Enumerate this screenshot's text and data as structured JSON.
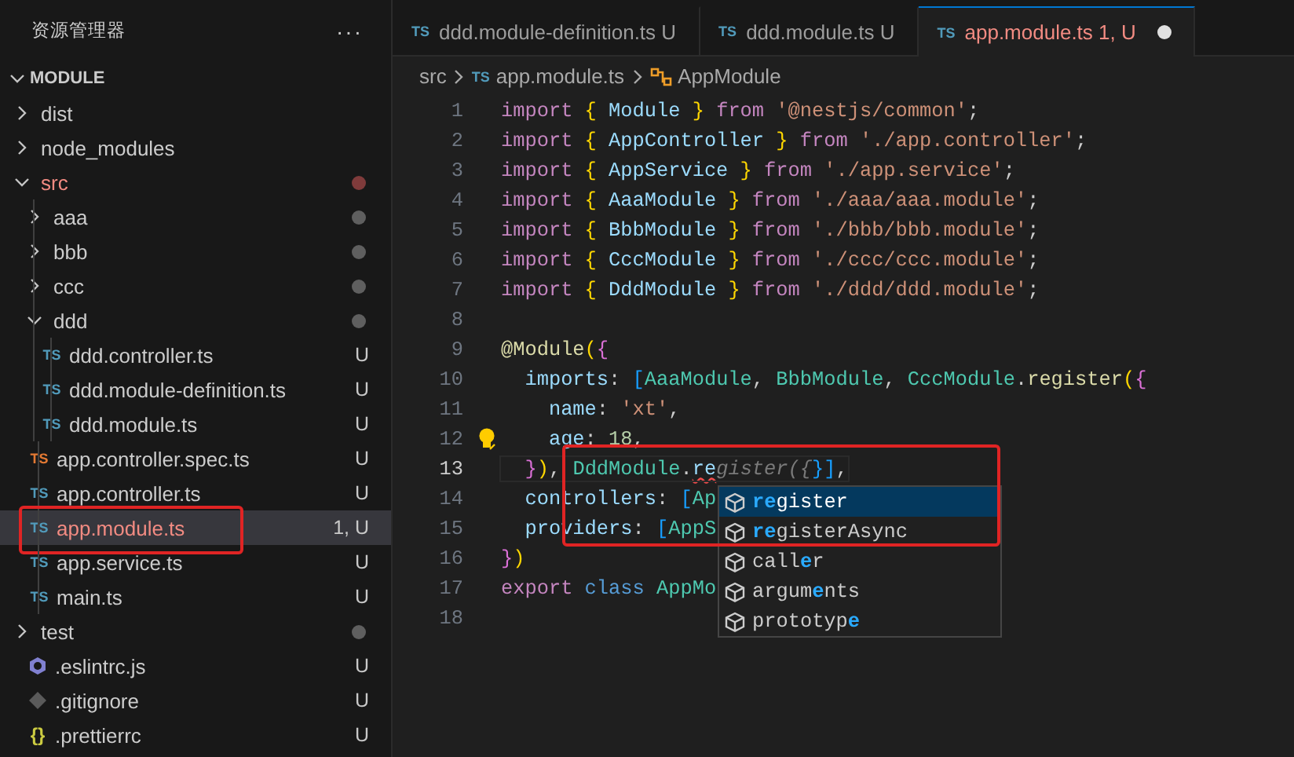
{
  "sidebar": {
    "title": "资源管理器",
    "menu": "···",
    "section": {
      "label": "MODULE",
      "expanded": true
    },
    "items": [
      {
        "label": "dist",
        "kind": "folder",
        "expanded": false,
        "problem": false
      },
      {
        "label": "node_modules",
        "kind": "folder",
        "expanded": false,
        "problem": false
      },
      {
        "label": "src",
        "kind": "folder",
        "expanded": true,
        "problem": true,
        "color": "#7f3b3b",
        "children": [
          {
            "label": "aaa",
            "kind": "folder",
            "expanded": false,
            "problem": false,
            "color": "#5f5f5f"
          },
          {
            "label": "bbb",
            "kind": "folder",
            "expanded": false,
            "problem": false,
            "color": "#5f5f5f"
          },
          {
            "label": "ccc",
            "kind": "folder",
            "expanded": false,
            "problem": false,
            "color": "#5f5f5f"
          },
          {
            "label": "ddd",
            "kind": "folder",
            "expanded": true,
            "problem": false,
            "color": "#5f5f5f",
            "children": [
              {
                "label": "ddd.controller.ts",
                "kind": "ts",
                "icon_label": "TS",
                "status": "U",
                "problem": false
              },
              {
                "label": "ddd.module-definition.ts",
                "kind": "ts",
                "icon_label": "TS",
                "status": "U",
                "problem": false
              },
              {
                "label": "ddd.module.ts",
                "kind": "ts",
                "icon_label": "TS",
                "status": "U",
                "problem": false
              }
            ]
          },
          {
            "label": "app.controller.spec.ts",
            "kind": "test",
            "icon_label": "TS",
            "status": "U",
            "problem": false
          },
          {
            "label": "app.controller.ts",
            "kind": "ts",
            "icon_label": "TS",
            "status": "U",
            "problem": false
          },
          {
            "label": "app.module.ts",
            "kind": "ts",
            "icon_label": "TS",
            "status": "1, U",
            "problem": true,
            "selected": true,
            "outlined": true
          },
          {
            "label": "app.service.ts",
            "kind": "ts",
            "icon_label": "TS",
            "status": "U",
            "problem": false
          },
          {
            "label": "main.ts",
            "kind": "ts",
            "icon_label": "TS",
            "status": "U",
            "problem": false
          }
        ]
      },
      {
        "label": "test",
        "kind": "folder",
        "expanded": false,
        "problem": false,
        "color": "#5f5f5f"
      },
      {
        "label": ".eslintrc.js",
        "kind": "eslint",
        "status": "U",
        "problem": false
      },
      {
        "label": ".gitignore",
        "kind": "git",
        "status": "U",
        "problem": false
      },
      {
        "label": ".prettierrc",
        "kind": "json",
        "icon_label": "{}",
        "status": "U",
        "problem": false
      }
    ]
  },
  "tabs": [
    {
      "icon_label": "TS",
      "label": "ddd.module-definition.ts",
      "status": "U",
      "selected": false,
      "problem": false,
      "modified": false
    },
    {
      "icon_label": "TS",
      "label": "ddd.module.ts",
      "status": "U",
      "selected": false,
      "problem": false,
      "modified": false
    },
    {
      "icon_label": "TS",
      "label": "app.module.ts",
      "status": "1, U",
      "selected": true,
      "problem": true,
      "modified": true
    }
  ],
  "breadcrumb": {
    "folder": "src",
    "icon_label": "TS",
    "file": "app.module.ts",
    "symbol": "AppModule"
  },
  "editor": {
    "outlined": true,
    "lines": [
      {
        "number": "1",
        "tokens": [
          {
            "kind": "kw",
            "t": "import "
          },
          {
            "kind": "br",
            "t": "{"
          },
          {
            "kind": "var",
            "t": " Module "
          },
          {
            "kind": "br",
            "t": "}"
          },
          {
            "kind": "kw",
            "t": " from "
          },
          {
            "kind": "str",
            "t": "'@nestjs/common'"
          },
          {
            "kind": "p",
            "t": ";"
          }
        ]
      },
      {
        "number": "2",
        "tokens": [
          {
            "kind": "kw",
            "t": "import "
          },
          {
            "kind": "br",
            "t": "{"
          },
          {
            "kind": "var",
            "t": " AppController "
          },
          {
            "kind": "br",
            "t": "}"
          },
          {
            "kind": "kw",
            "t": " from "
          },
          {
            "kind": "str",
            "t": "'./app.controller'"
          },
          {
            "kind": "p",
            "t": ";"
          }
        ]
      },
      {
        "number": "3",
        "tokens": [
          {
            "kind": "kw",
            "t": "import "
          },
          {
            "kind": "br",
            "t": "{"
          },
          {
            "kind": "var",
            "t": " AppService "
          },
          {
            "kind": "br",
            "t": "}"
          },
          {
            "kind": "kw",
            "t": " from "
          },
          {
            "kind": "str",
            "t": "'./app.service'"
          },
          {
            "kind": "p",
            "t": ";"
          }
        ]
      },
      {
        "number": "4",
        "tokens": [
          {
            "kind": "kw",
            "t": "import "
          },
          {
            "kind": "br",
            "t": "{"
          },
          {
            "kind": "var",
            "t": " AaaModule "
          },
          {
            "kind": "br",
            "t": "}"
          },
          {
            "kind": "kw",
            "t": " from "
          },
          {
            "kind": "str",
            "t": "'./aaa/aaa.module'"
          },
          {
            "kind": "p",
            "t": ";"
          }
        ]
      },
      {
        "number": "5",
        "tokens": [
          {
            "kind": "kw",
            "t": "import "
          },
          {
            "kind": "br",
            "t": "{"
          },
          {
            "kind": "var",
            "t": " BbbModule "
          },
          {
            "kind": "br",
            "t": "}"
          },
          {
            "kind": "kw",
            "t": " from "
          },
          {
            "kind": "str",
            "t": "'./bbb/bbb.module'"
          },
          {
            "kind": "p",
            "t": ";"
          }
        ]
      },
      {
        "number": "6",
        "tokens": [
          {
            "kind": "kw",
            "t": "import "
          },
          {
            "kind": "br",
            "t": "{"
          },
          {
            "kind": "var",
            "t": " CccModule "
          },
          {
            "kind": "br",
            "t": "}"
          },
          {
            "kind": "kw",
            "t": " from "
          },
          {
            "kind": "str",
            "t": "'./ccc/ccc.module'"
          },
          {
            "kind": "p",
            "t": ";"
          }
        ]
      },
      {
        "number": "7",
        "tokens": [
          {
            "kind": "kw",
            "t": "import "
          },
          {
            "kind": "br",
            "t": "{"
          },
          {
            "kind": "var",
            "t": " DddModule "
          },
          {
            "kind": "br",
            "t": "}"
          },
          {
            "kind": "kw",
            "t": " from "
          },
          {
            "kind": "str",
            "t": "'./ddd/ddd.module'"
          },
          {
            "kind": "p",
            "t": ";"
          }
        ]
      },
      {
        "number": "8"
      },
      {
        "number": "9",
        "tokens": [
          {
            "kind": "fn",
            "t": "@Module"
          },
          {
            "kind": "br",
            "t": "("
          },
          {
            "kind": "br2",
            "t": "{"
          }
        ]
      },
      {
        "number": "10",
        "tokens": [
          {
            "kind": "var",
            "t": "  imports"
          },
          {
            "kind": "p",
            "t": ": "
          },
          {
            "kind": "br3",
            "t": "["
          },
          {
            "kind": "type",
            "t": "AaaModule"
          },
          {
            "kind": "p",
            "t": ", "
          },
          {
            "kind": "type",
            "t": "BbbModule"
          },
          {
            "kind": "p",
            "t": ", "
          },
          {
            "kind": "type",
            "t": "CccModule"
          },
          {
            "kind": "p",
            "t": "."
          },
          {
            "kind": "fn",
            "t": "register"
          },
          {
            "kind": "br",
            "t": "("
          },
          {
            "kind": "br2",
            "t": "{"
          }
        ]
      },
      {
        "number": "11",
        "tokens": [
          {
            "kind": "var",
            "t": "    name"
          },
          {
            "kind": "p",
            "t": ": "
          },
          {
            "kind": "str",
            "t": "'xt'"
          },
          {
            "kind": "p",
            "t": ","
          }
        ]
      },
      {
        "number": "12",
        "lightbulb": true,
        "tokens": [
          {
            "kind": "var",
            "t": "    age"
          },
          {
            "kind": "p",
            "t": ": "
          },
          {
            "kind": "num",
            "t": "18"
          },
          {
            "kind": "p",
            "t": ","
          }
        ]
      },
      {
        "number": "13",
        "current": true,
        "tokens": [
          {
            "kind": "br2",
            "t": "  }"
          },
          {
            "kind": "br",
            "t": ")"
          },
          {
            "kind": "p",
            "t": ", "
          },
          {
            "kind": "type",
            "t": "DddModule"
          },
          {
            "kind": "p",
            "t": "."
          },
          {
            "kind": "err",
            "t": "re"
          },
          {
            "kind": "ghost",
            "t": "gister({"
          },
          {
            "kind": "br3",
            "t": "}]"
          },
          {
            "kind": "p",
            "t": ","
          }
        ]
      },
      {
        "number": "14",
        "tokens": [
          {
            "kind": "var",
            "t": "  controllers"
          },
          {
            "kind": "p",
            "t": ": "
          },
          {
            "kind": "br3",
            "t": "["
          },
          {
            "kind": "type",
            "t": "Ap"
          }
        ]
      },
      {
        "number": "15",
        "tokens": [
          {
            "kind": "var",
            "t": "  providers"
          },
          {
            "kind": "p",
            "t": ": "
          },
          {
            "kind": "br3",
            "t": "["
          },
          {
            "kind": "type",
            "t": "AppS"
          }
        ]
      },
      {
        "number": "16",
        "tokens": [
          {
            "kind": "br2",
            "t": "}"
          },
          {
            "kind": "br",
            "t": ")"
          }
        ]
      },
      {
        "number": "17",
        "tokens": [
          {
            "kind": "kw",
            "t": "export"
          },
          {
            "kind": "cls",
            "t": " class "
          },
          {
            "kind": "type",
            "t": "AppMo"
          }
        ]
      },
      {
        "number": "18"
      }
    ],
    "suggestions": [
      {
        "selected": true,
        "parts": [
          {
            "t": "re",
            "kind": "match"
          },
          {
            "t": "gister",
            "kind": "plain"
          }
        ]
      },
      {
        "selected": false,
        "parts": [
          {
            "t": "re",
            "kind": "match"
          },
          {
            "t": "gisterAsync",
            "kind": "plain"
          }
        ]
      },
      {
        "selected": false,
        "parts": [
          {
            "t": "call",
            "kind": "plain"
          },
          {
            "t": "e",
            "kind": "match"
          },
          {
            "t": "r",
            "kind": "plain"
          }
        ]
      },
      {
        "selected": false,
        "parts": [
          {
            "t": "argum",
            "kind": "plain"
          },
          {
            "t": "e",
            "kind": "match"
          },
          {
            "t": "nts",
            "kind": "plain"
          }
        ]
      },
      {
        "selected": false,
        "parts": [
          {
            "t": "prototyp",
            "kind": "plain"
          },
          {
            "t": "e",
            "kind": "match"
          }
        ]
      }
    ]
  }
}
